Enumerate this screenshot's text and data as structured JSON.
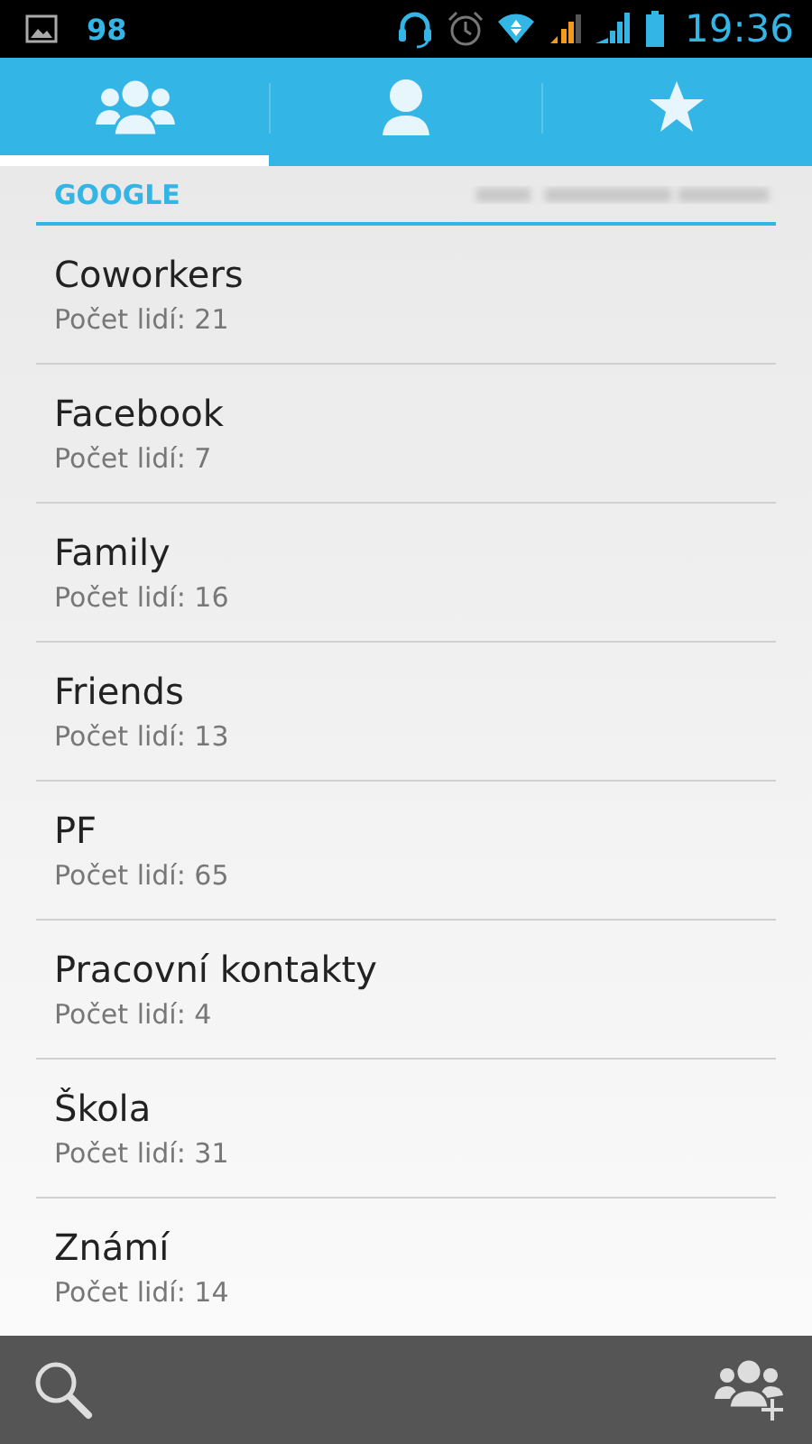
{
  "status_bar": {
    "notification_count": "98",
    "time": "19:36"
  },
  "tabs": [
    {
      "selected": true
    },
    {
      "selected": false
    },
    {
      "selected": false
    }
  ],
  "section": {
    "title": "GOOGLE"
  },
  "groups": [
    {
      "name": "Coworkers",
      "count": "Počet lidí: 21"
    },
    {
      "name": "Facebook",
      "count": "Počet lidí: 7"
    },
    {
      "name": "Family",
      "count": "Počet lidí: 16"
    },
    {
      "name": "Friends",
      "count": "Počet lidí: 13"
    },
    {
      "name": "PF",
      "count": "Počet lidí: 65"
    },
    {
      "name": "Pracovní kontakty",
      "count": "Počet lidí: 4"
    },
    {
      "name": "Škola",
      "count": "Počet lidí: 31"
    },
    {
      "name": "Známí",
      "count": "Počet lidí: 14"
    }
  ]
}
